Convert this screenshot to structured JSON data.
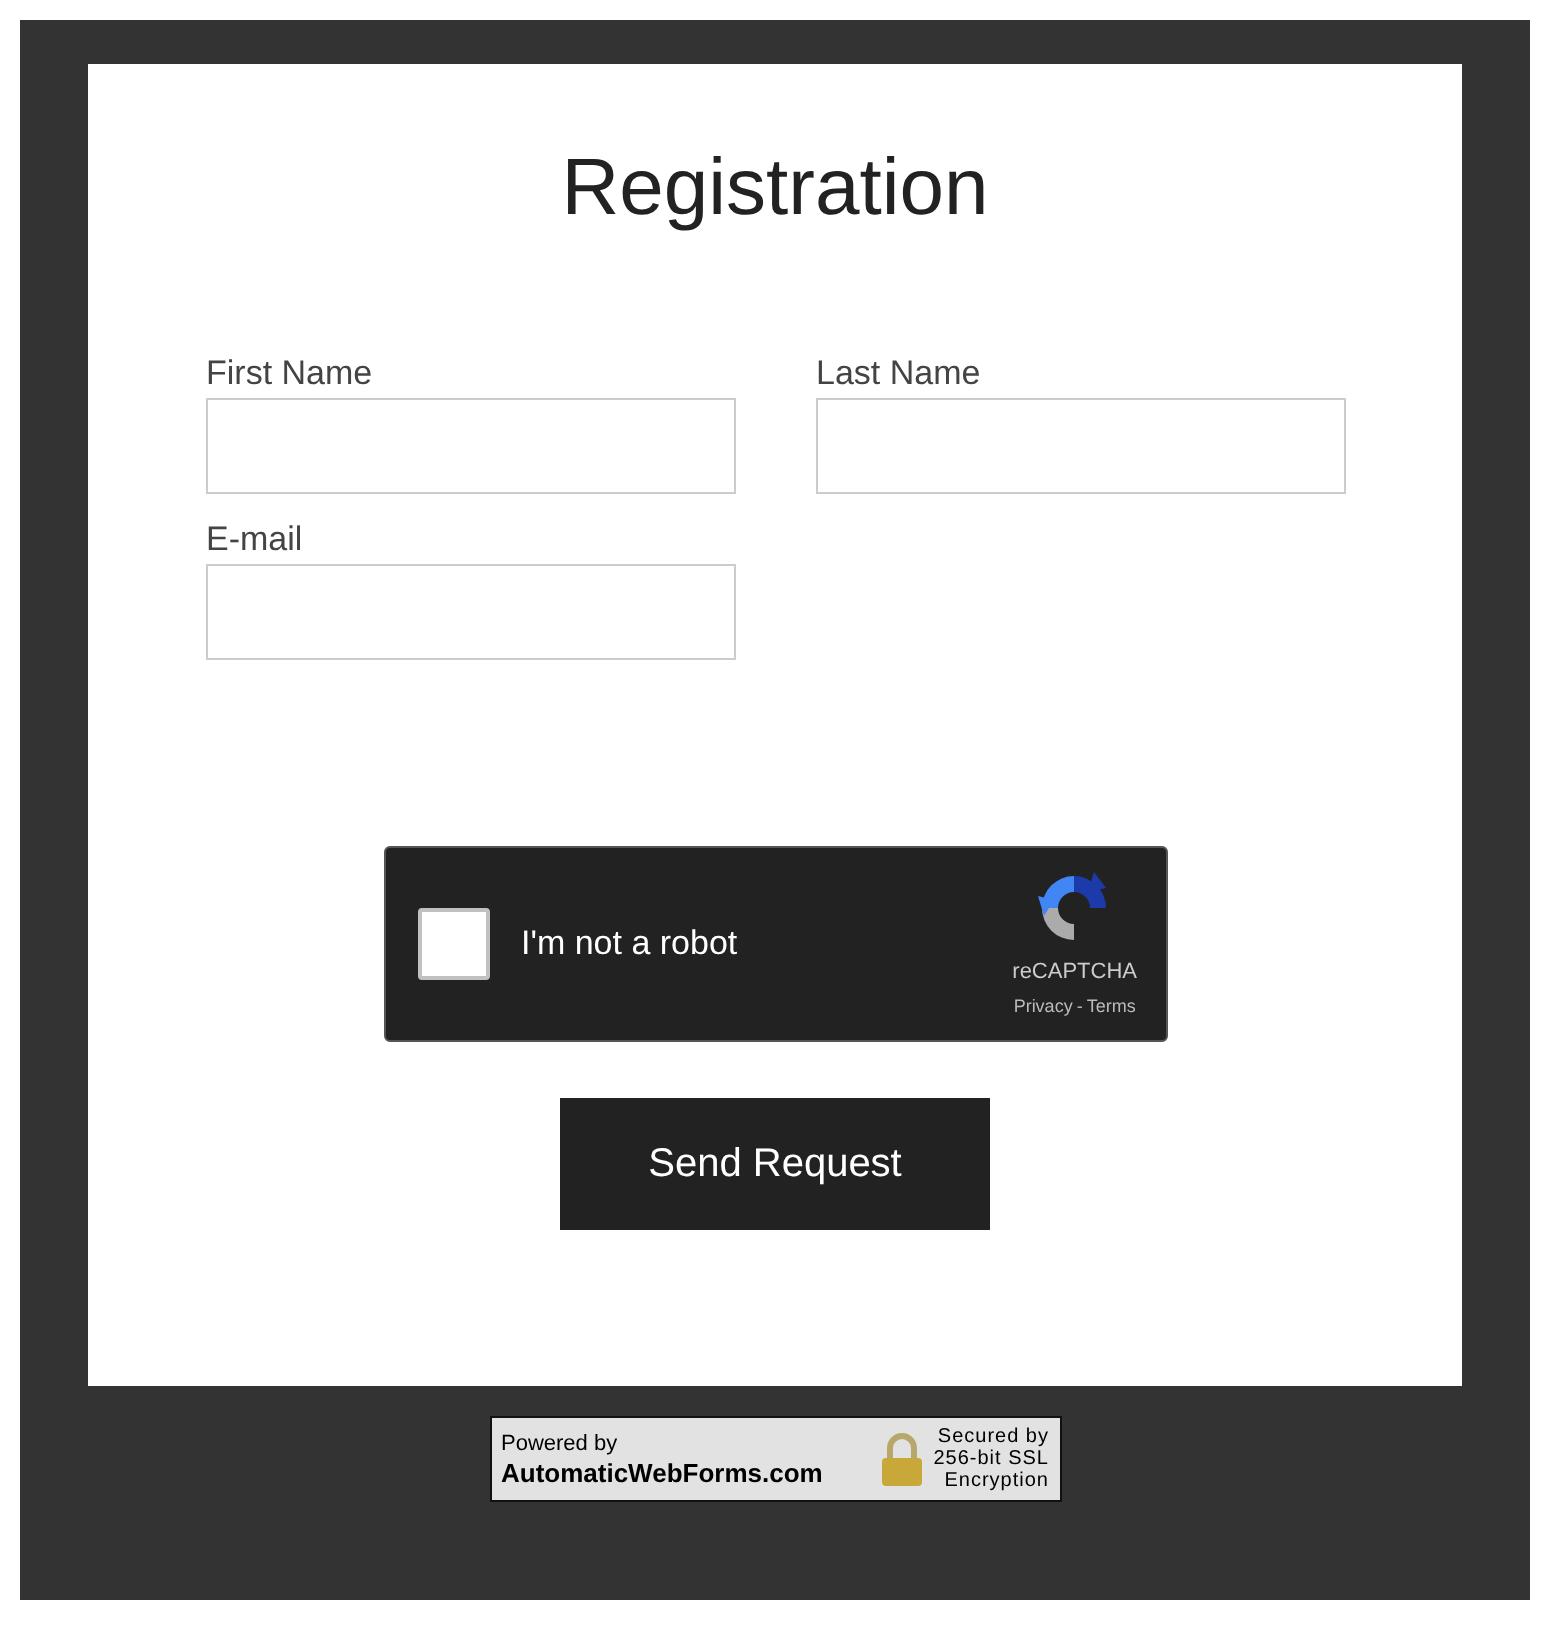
{
  "form": {
    "title": "Registration",
    "fields": [
      {
        "label": "First Name"
      },
      {
        "label": "Last Name"
      },
      {
        "label": "E-mail"
      }
    ],
    "captcha": {
      "label": "I'm not a robot",
      "checked": false,
      "brand": "reCAPTCHA",
      "links": [
        "Privacy",
        "-",
        "Terms"
      ]
    },
    "submit": "Send Request"
  },
  "badge": {
    "powered": "Powered by",
    "site": "AutomaticWebForms.com",
    "secured": [
      "Secured by",
      "256-bit SSL",
      "Encryption"
    ]
  }
}
